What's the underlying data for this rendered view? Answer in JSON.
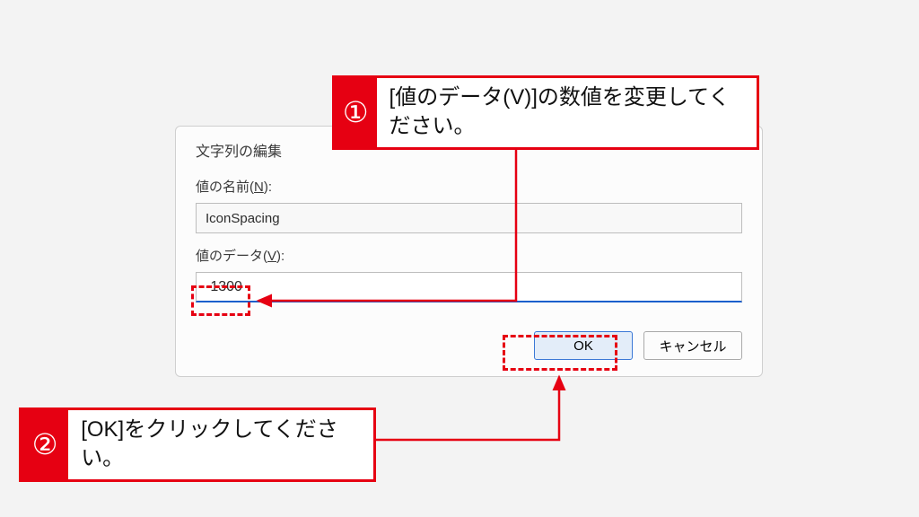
{
  "dialog": {
    "title": "文字列の編集",
    "close_glyph": "✕",
    "name_label_pre": "値の名前(",
    "name_label_ul": "N",
    "name_label_post": "):",
    "name_value": "IconSpacing",
    "data_label_pre": "値のデータ(",
    "data_label_ul": "V",
    "data_label_post": "):",
    "data_value": "-1300",
    "ok_label": "OK",
    "cancel_label": "キャンセル"
  },
  "callouts": {
    "c1": {
      "num": "①",
      "text": "[値のデータ(V)]の数値を変更してください。"
    },
    "c2": {
      "num": "②",
      "text": "[OK]をクリックしてください。"
    }
  }
}
